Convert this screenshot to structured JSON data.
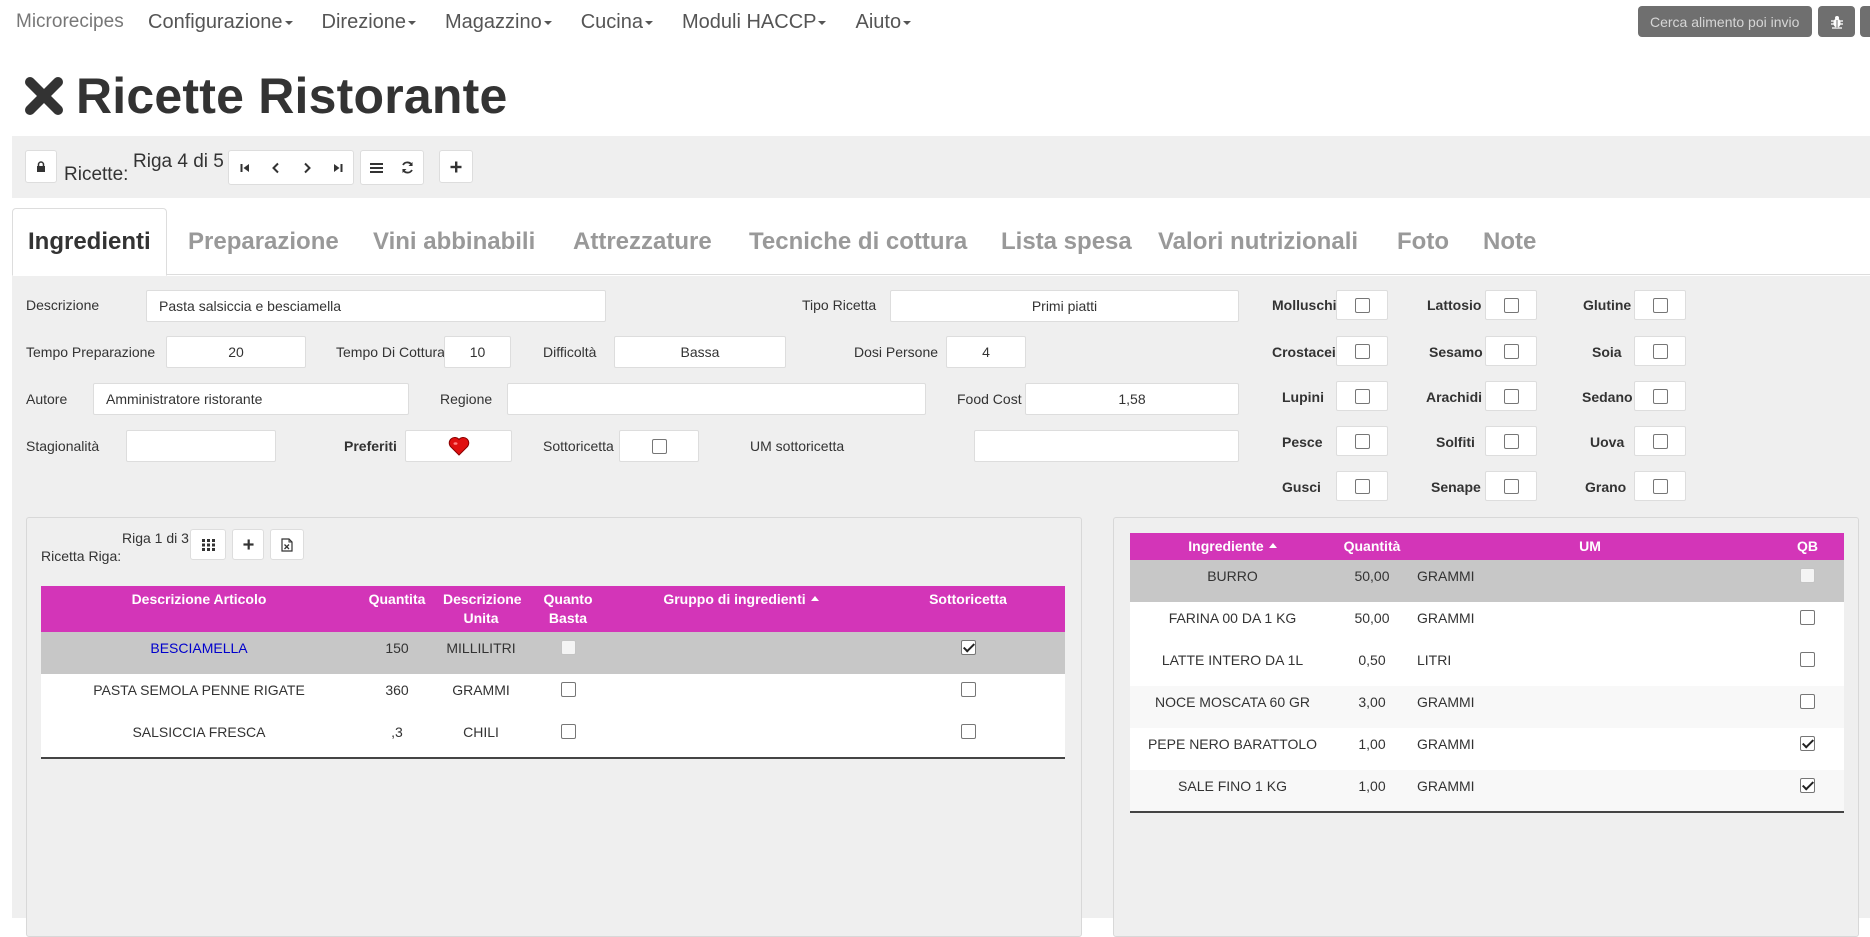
{
  "navbar": {
    "brand": "Microrecipes",
    "menu": [
      "Configurazione",
      "Direzione",
      "Magazzino",
      "Cucina",
      "Moduli HACCP",
      "Aiuto"
    ],
    "search_placeholder": "Cerca alimento poi invio"
  },
  "page": {
    "title": "Ricette Ristorante"
  },
  "record_nav": {
    "label": "Ricette:",
    "position": "Riga 4 di 5"
  },
  "tabs": [
    "Ingredienti",
    "Preparazione",
    "Vini abbinabili",
    "Attrezzature",
    "Tecniche di cottura",
    "Lista spesa",
    "Valori nutrizionali",
    "Foto",
    "Note"
  ],
  "form": {
    "descrizione": {
      "label": "Descrizione",
      "value": "Pasta salsiccia e besciamella"
    },
    "tipo_ricetta": {
      "label": "Tipo Ricetta",
      "value": "Primi piatti"
    },
    "tempo_preparazione": {
      "label": "Tempo Preparazione",
      "value": "20"
    },
    "tempo_cottura": {
      "label": "Tempo Di Cottura",
      "value": "10"
    },
    "difficolta": {
      "label": "Difficoltà",
      "value": "Bassa"
    },
    "dosi_persone": {
      "label": "Dosi Persone",
      "value": "4"
    },
    "autore": {
      "label": "Autore",
      "value": "Amministratore ristorante"
    },
    "regione": {
      "label": "Regione",
      "value": ""
    },
    "food_cost": {
      "label": "Food Cost",
      "value": "1,58"
    },
    "stagionalita": {
      "label": "Stagionalità",
      "value": ""
    },
    "preferiti": {
      "label": "Preferiti"
    },
    "sottoricetta": {
      "label": "Sottoricetta",
      "checked": false
    },
    "um_sottoricetta": {
      "label": "UM sottoricetta",
      "value": ""
    }
  },
  "allergens": [
    [
      {
        "name": "Molluschi",
        "checked": false
      },
      {
        "name": "Lattosio",
        "checked": false
      },
      {
        "name": "Glutine",
        "checked": false
      }
    ],
    [
      {
        "name": "Crostacei",
        "checked": false
      },
      {
        "name": "Sesamo",
        "checked": false
      },
      {
        "name": "Soia",
        "checked": false
      }
    ],
    [
      {
        "name": "Lupini",
        "checked": false
      },
      {
        "name": "Arachidi",
        "checked": false
      },
      {
        "name": "Sedano",
        "checked": false
      }
    ],
    [
      {
        "name": "Pesce",
        "checked": false
      },
      {
        "name": "Solfiti",
        "checked": false
      },
      {
        "name": "Uova",
        "checked": false
      }
    ],
    [
      {
        "name": "Gusci",
        "checked": false
      },
      {
        "name": "Senape",
        "checked": false
      },
      {
        "name": "Grano",
        "checked": false
      }
    ]
  ],
  "recipe_rows": {
    "label": "Ricetta Riga:",
    "position": "Riga 1 di 3",
    "columns": [
      "Descrizione Articolo",
      "Quantita",
      "Descrizione Unita",
      "Quanto Basta",
      "Gruppo di ingredienti",
      "Sottoricetta"
    ],
    "rows": [
      {
        "articolo": "BESCIAMELLA",
        "quantita": "150",
        "unita": "MILLILITRI",
        "quanto_basta": false,
        "gruppo": "",
        "sottoricetta": true
      },
      {
        "articolo": "PASTA SEMOLA PENNE RIGATE",
        "quantita": "360",
        "unita": "GRAMMI",
        "quanto_basta": false,
        "gruppo": "",
        "sottoricetta": false
      },
      {
        "articolo": "SALSICCIA FRESCA",
        "quantita": ",3",
        "unita": "CHILI",
        "quanto_basta": false,
        "gruppo": "",
        "sottoricetta": false
      }
    ]
  },
  "sub_ingredients": {
    "columns": [
      "Ingrediente",
      "Quantità",
      "UM",
      "QB"
    ],
    "rows": [
      {
        "ingrediente": "BURRO",
        "quantita": "50,00",
        "um": "GRAMMI",
        "qb": false
      },
      {
        "ingrediente": "FARINA 00 DA 1 KG",
        "quantita": "50,00",
        "um": "GRAMMI",
        "qb": false
      },
      {
        "ingrediente": "LATTE INTERO DA 1L",
        "quantita": "0,50",
        "um": "LITRI",
        "qb": false
      },
      {
        "ingrediente": "NOCE MOSCATA 60 GR",
        "quantita": "3,00",
        "um": "GRAMMI",
        "qb": false
      },
      {
        "ingrediente": "PEPE NERO BARATTOLO",
        "quantita": "1,00",
        "um": "GRAMMI",
        "qb": true
      },
      {
        "ingrediente": "SALE FINO 1 KG",
        "quantita": "1,00",
        "um": "GRAMMI",
        "qb": true
      }
    ]
  },
  "colors": {
    "header_magenta": "#d335b8",
    "selected_row": "#c7c7c7",
    "link_blue": "#0000cc",
    "ingredient_red": "#a02020"
  }
}
